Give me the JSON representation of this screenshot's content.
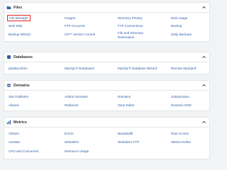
{
  "colors": {
    "link": "#2f5ea8",
    "highlight_border": "#e32222",
    "background": "#f2f3f5",
    "header_icon": "#2f5ea8"
  },
  "sections": [
    {
      "title": "Files",
      "icon": "folder-icon",
      "items": [
        "File Manager",
        "Images",
        "Directory Privacy",
        "Disk Usage",
        "Web Disk",
        "FTP Accounts",
        "FTP Connections",
        "Backup",
        "Backup Wizard",
        "Git™ Version Control",
        "File and Directory",
        "Restoration",
        "Daily Backups"
      ]
    },
    {
      "title": "Databases",
      "icon": "database-icon",
      "items": [
        "phpMyAdmin",
        "MySQL® Databases",
        "MySQL® Database Wizard",
        "Remote MySQL®"
      ]
    },
    {
      "title": "Domains",
      "icon": "globe-icon",
      "items": [
        "Site Publisher",
        "Addon Domains",
        "Domains",
        "Subdomains",
        "Aliases",
        "Redirects",
        "Zone Editor",
        "Dynamic DNS"
      ]
    },
    {
      "title": "Metrics",
      "icon": "chart-icon",
      "items": [
        "Visitors",
        "Errors",
        "Bandwidth",
        "Raw Access",
        "Awstats",
        "Webalizer",
        "Webalizer FTP",
        "Metrics Editor",
        "CPU and Concurrent",
        "Resource Usage"
      ]
    }
  ]
}
